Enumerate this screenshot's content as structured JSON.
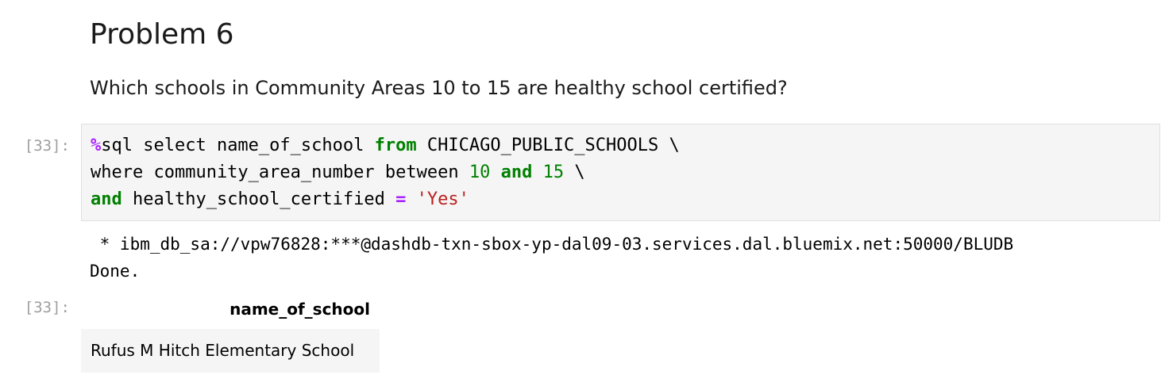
{
  "markdown": {
    "heading": "Problem 6",
    "question": "Which schools in Community Areas 10 to 15 are healthy school certified?"
  },
  "input_prompt": "[33]:",
  "output_prompt": "[33]:",
  "code": {
    "line1": {
      "magic": "%",
      "text1": "sql select name_of_school ",
      "kw1": "from",
      "text2": " CHICAGO_PUBLIC_SCHOOLS \\"
    },
    "line2": {
      "text1": "where community_area_number between ",
      "num1": "10",
      "sp1": " ",
      "kw1": "and",
      "sp2": " ",
      "num2": "15",
      "text2": " \\"
    },
    "line3": {
      "kw1": "and",
      "text1": " healthy_school_certified ",
      "op": "=",
      "sp": " ",
      "str": "'Yes'"
    }
  },
  "output": {
    "connection": " * ibm_db_sa://vpw76828:***@dashdb-txn-sbox-yp-dal09-03.services.dal.bluemix.net:50000/BLUDB",
    "status": "Done."
  },
  "result_table": {
    "columns": [
      "name_of_school"
    ],
    "rows": [
      [
        "Rufus M Hitch Elementary School"
      ]
    ]
  },
  "colors": {
    "keyword": "#008000",
    "magic": "#aa22ff",
    "string": "#ba2121",
    "prompt": "#9e9e9e",
    "cell_bg": "#f5f5f5"
  }
}
